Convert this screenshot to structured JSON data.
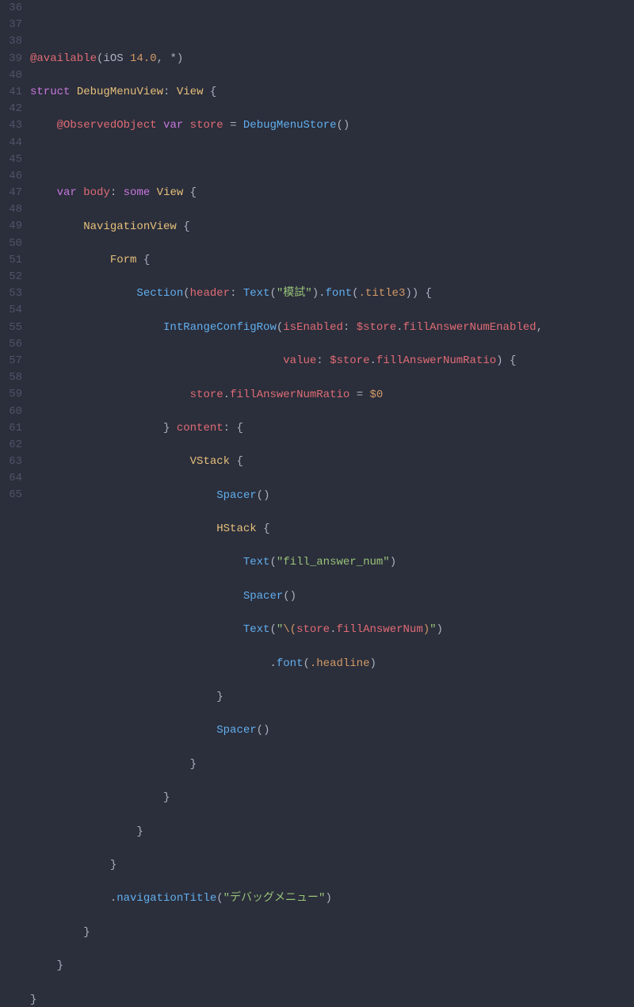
{
  "lineStart": 36,
  "lineEnd": 65,
  "tokens": {
    "l37": {
      "a": "@available",
      "b": "(iOS ",
      "c": "14.0",
      "d": ", *)"
    },
    "l38": {
      "a": "struct",
      "b": "DebugMenuView",
      "c": ": ",
      "d": "View",
      "e": " {"
    },
    "l39": {
      "a": "    ",
      "b": "@ObservedObject",
      "c": " ",
      "d": "var",
      "e": " ",
      "f": "store",
      "g": " = ",
      "h": "DebugMenuStore",
      "i": "()"
    },
    "l41": {
      "a": "    ",
      "b": "var",
      "c": " ",
      "d": "body",
      "e": ": ",
      "f": "some",
      "g": " ",
      "h": "View",
      "i": " {"
    },
    "l42": {
      "a": "        ",
      "b": "NavigationView",
      "c": " {"
    },
    "l43": {
      "a": "            ",
      "b": "Form",
      "c": " {"
    },
    "l44": {
      "a": "                ",
      "b": "Section",
      "c": "(",
      "d": "header",
      "e": ": ",
      "f": "Text",
      "g": "(",
      "h": "\"模試\"",
      "i": ").",
      "j": "font",
      "k": "(",
      "l": ".title3",
      "m": ")) {"
    },
    "l45": {
      "a": "                    ",
      "b": "IntRangeConfigRow",
      "c": "(",
      "d": "isEnabled",
      "e": ": ",
      "f": "$store",
      "g": ".",
      "h": "fillAnswerNumEnabled",
      "i": ","
    },
    "l46": {
      "a": "                                      ",
      "b": "value",
      "c": ": ",
      "d": "$store",
      "e": ".",
      "f": "fillAnswerNumRatio",
      "g": ") {"
    },
    "l47": {
      "a": "                        ",
      "b": "store",
      "c": ".",
      "d": "fillAnswerNumRatio",
      "e": " = ",
      "f": "$0"
    },
    "l48": {
      "a": "                    } ",
      "b": "content",
      "c": ": {"
    },
    "l49": {
      "a": "                        ",
      "b": "VStack",
      "c": " {"
    },
    "l50": {
      "a": "                            ",
      "b": "Spacer",
      "c": "()"
    },
    "l51": {
      "a": "                            ",
      "b": "HStack",
      "c": " {"
    },
    "l52": {
      "a": "                                ",
      "b": "Text",
      "c": "(",
      "d": "\"fill_answer_num\"",
      "e": ")"
    },
    "l53": {
      "a": "                                ",
      "b": "Spacer",
      "c": "()"
    },
    "l54": {
      "a": "                                ",
      "b": "Text",
      "c": "(",
      "d": "\"",
      "e": "\\(",
      "f": "store",
      "g": ".",
      "h": "fillAnswerNum",
      "i": ")",
      "j": "\"",
      "k": ")"
    },
    "l55": {
      "a": "                                    .",
      "b": "font",
      "c": "(",
      "d": ".headline",
      "e": ")"
    },
    "l56": {
      "a": "                            }"
    },
    "l57": {
      "a": "                            ",
      "b": "Spacer",
      "c": "()"
    },
    "l58": {
      "a": "                        }"
    },
    "l59": {
      "a": "                    }"
    },
    "l60": {
      "a": "                }"
    },
    "l61": {
      "a": "            }"
    },
    "l62": {
      "a": "            .",
      "b": "navigationTitle",
      "c": "(",
      "d": "\"デバッグメニュー\"",
      "e": ")"
    },
    "l63": {
      "a": "        }"
    },
    "l64": {
      "a": "    }"
    },
    "l65": {
      "a": "}"
    }
  }
}
